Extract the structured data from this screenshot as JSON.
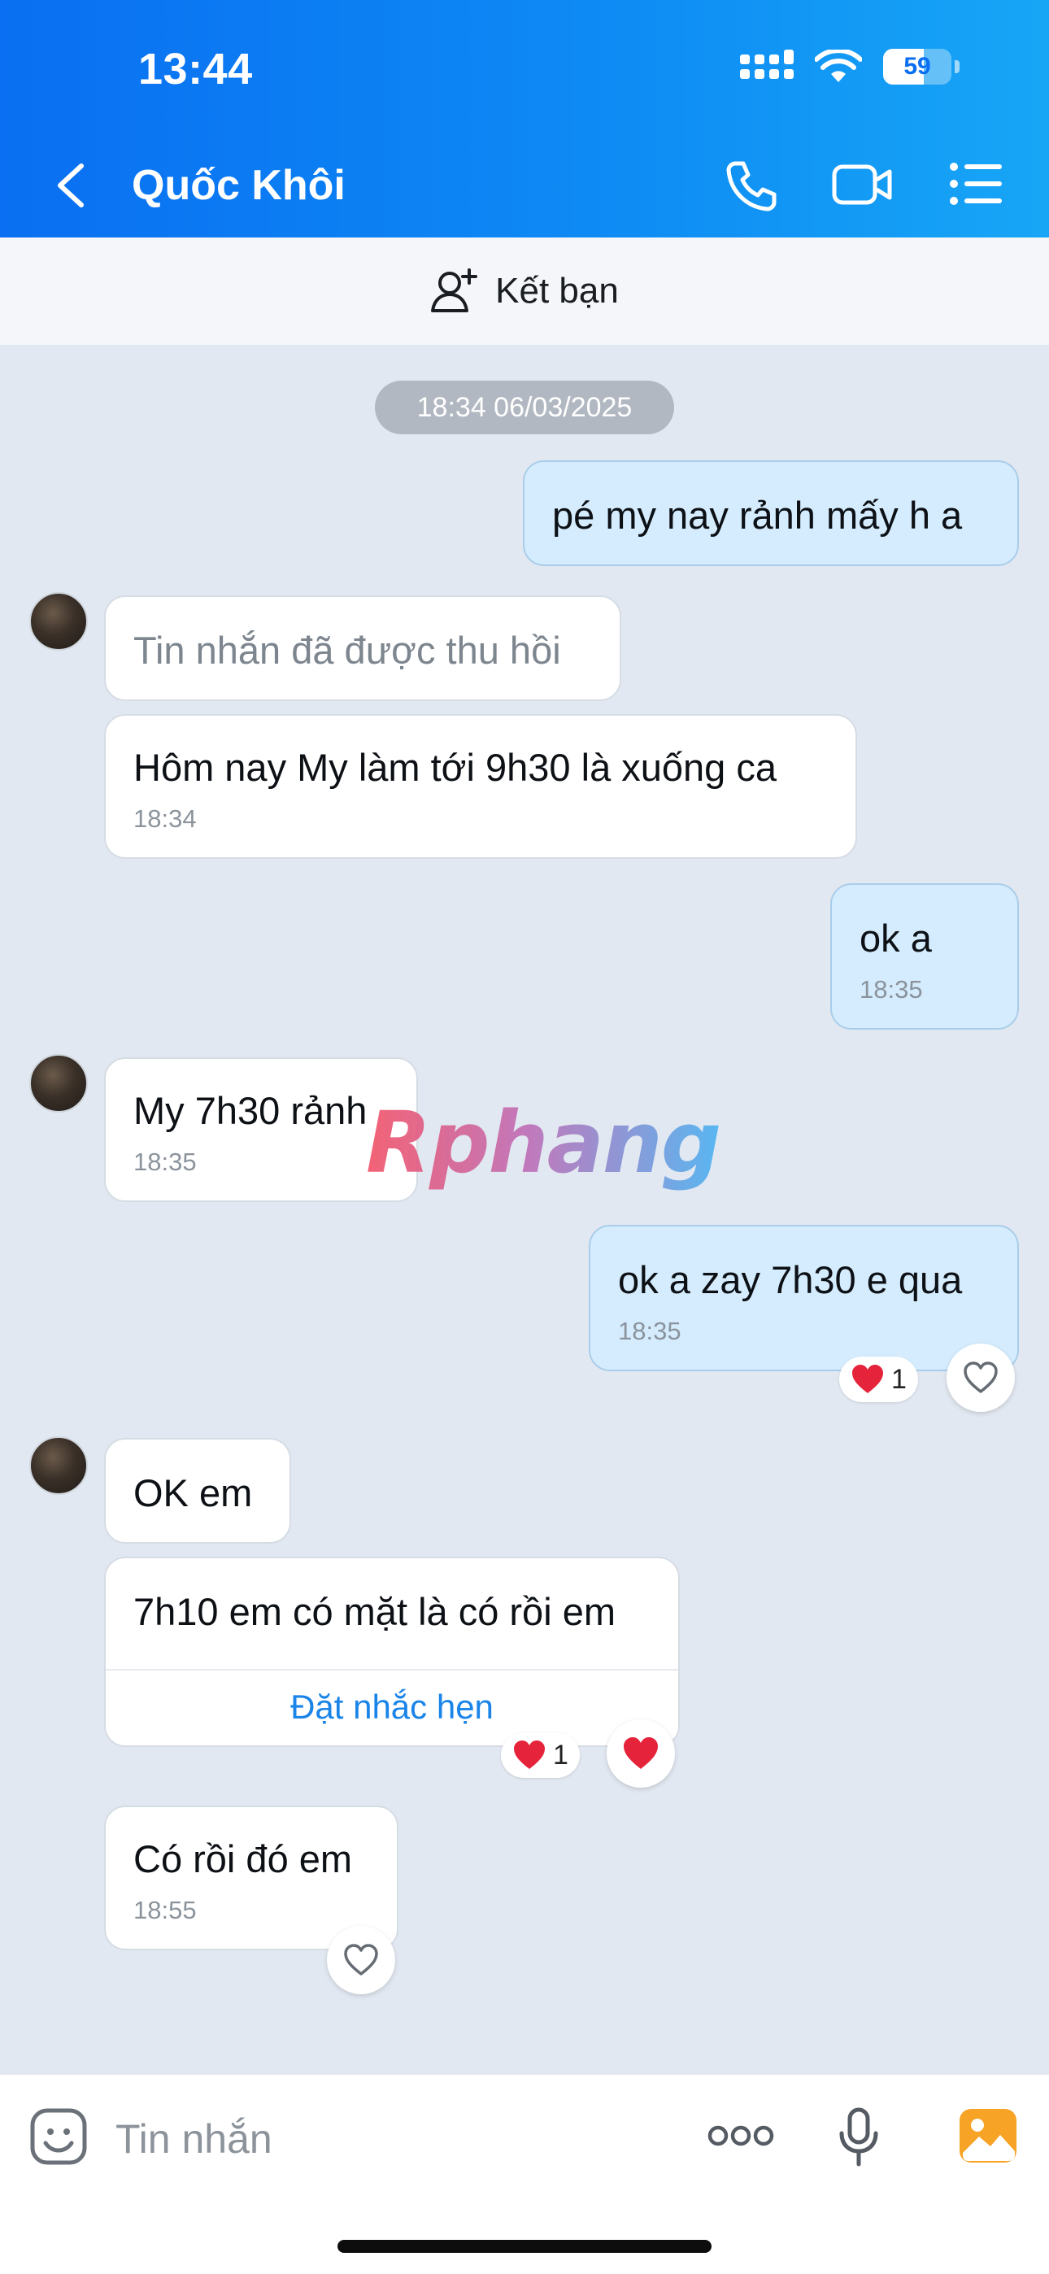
{
  "status_bar": {
    "time": "13:44",
    "battery": "59",
    "battery_level": 0.59
  },
  "header": {
    "contact_name": "Quốc Khôi"
  },
  "add_friend": {
    "label": "Kết bạn"
  },
  "conversation": {
    "date_separator": "18:34 06/03/2025",
    "messages": [
      {
        "side": "out",
        "text": "pé my nay rảnh mấy h a"
      },
      {
        "side": "in",
        "text": "Tin nhắn đã được thu hồi"
      },
      {
        "side": "in",
        "text": "Hôm nay My làm tới 9h30 là xuống ca",
        "time": "18:34"
      },
      {
        "side": "out",
        "text": "ok a",
        "time": "18:35"
      },
      {
        "side": "in",
        "text": "My 7h30 rảnh",
        "time": "18:35"
      },
      {
        "side": "out",
        "text": "ok a zay 7h30 e qua",
        "time": "18:35",
        "reaction_count": "1"
      },
      {
        "side": "in",
        "text": "OK em"
      },
      {
        "side": "in",
        "text": "7h10 em có mặt là có rồi em",
        "action": "Đặt nhắc hẹn",
        "reaction_count": "1"
      },
      {
        "side": "in",
        "text": "Có rồi đó em",
        "time": "18:55"
      }
    ]
  },
  "watermark": "Rphang",
  "composer": {
    "placeholder": "Tin nhắn"
  },
  "colors": {
    "header_start": "#0a6ff2",
    "header_end": "#17a6f6",
    "out_bubble": "#d4ecfd",
    "in_bubble": "#ffffff",
    "chat_bg": "#e2e8f1",
    "link": "#1a84e8"
  }
}
